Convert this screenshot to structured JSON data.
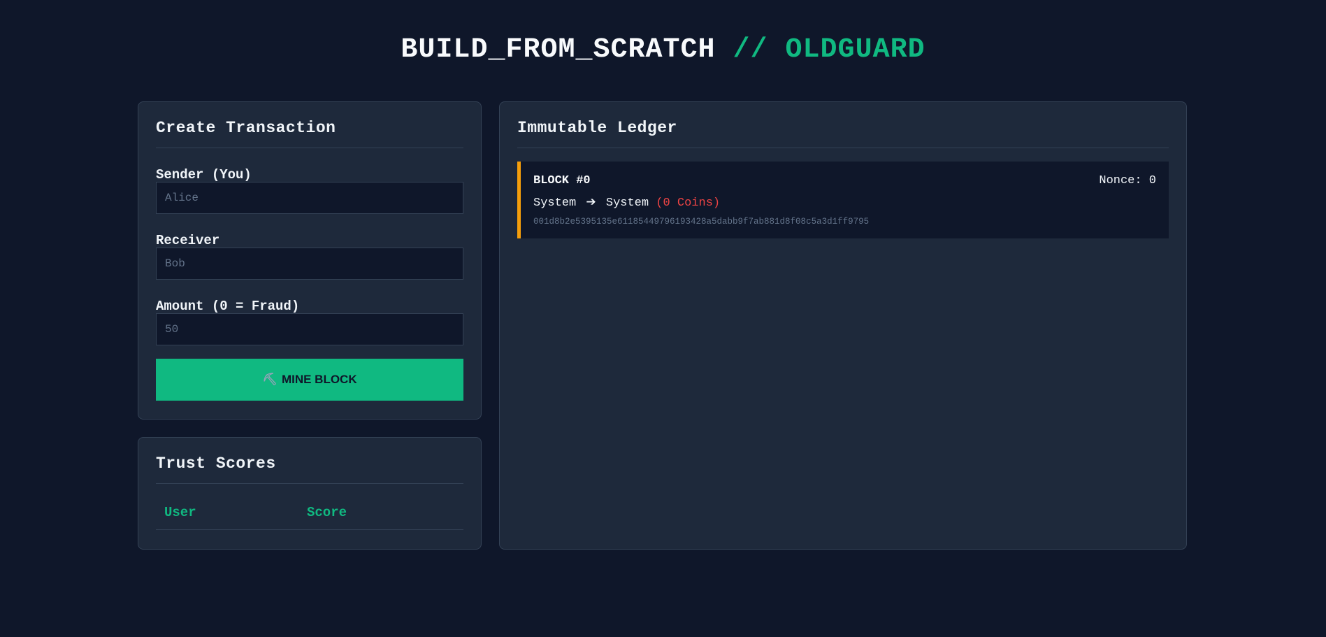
{
  "header": {
    "title_main": "BUILD_FROM_SCRATCH",
    "title_sep": "//",
    "title_brand": "OLDGUARD",
    "accent_color": "#10b981"
  },
  "transaction_form": {
    "title": "Create Transaction",
    "sender_label": "Sender (You)",
    "sender_placeholder": "Alice",
    "receiver_label": "Receiver",
    "receiver_placeholder": "Bob",
    "amount_label": "Amount (0 = Fraud)",
    "amount_placeholder": "50",
    "mine_icon": "pickaxe-icon",
    "mine_label": "MINE BLOCK"
  },
  "trust_scores": {
    "title": "Trust Scores",
    "columns": [
      "User",
      "Score"
    ],
    "rows": []
  },
  "ledger": {
    "title": "Immutable Ledger",
    "blocks": [
      {
        "title": "BLOCK #0",
        "nonce": "Nonce: 0",
        "sender": "System",
        "receiver": "System",
        "amount": "(0 Coins)",
        "hash": "001d8b2e5395135e61185449796193428a5dabb9f7ab881d8f08c5a3d1ff9795",
        "border_color": "#f59e0b"
      }
    ]
  }
}
